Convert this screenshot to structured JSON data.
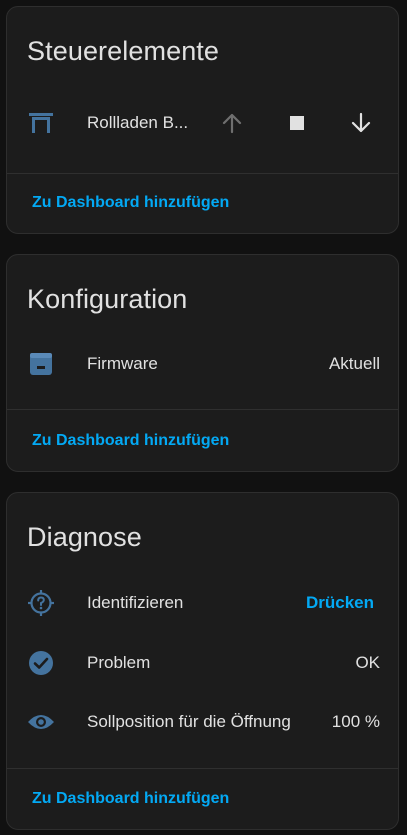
{
  "colors": {
    "accent": "#03a9f4",
    "icon": "#44739e",
    "text": "#e1e1e1",
    "disabled": "#6f6f6f"
  },
  "controls": {
    "title": "Steuerelemente",
    "entity": {
      "icon": "blinds-icon",
      "label": "Rollladen B..."
    },
    "buttons": [
      {
        "icon": "arrow-up-icon",
        "enabled": false
      },
      {
        "icon": "stop-icon",
        "enabled": true
      },
      {
        "icon": "arrow-down-icon",
        "enabled": true
      }
    ],
    "add_label": "Zu Dashboard hinzufügen"
  },
  "config": {
    "title": "Konfiguration",
    "rows": [
      {
        "icon": "package-icon",
        "label": "Firmware",
        "value": "Aktuell"
      }
    ],
    "add_label": "Zu Dashboard hinzufügen"
  },
  "diagnostics": {
    "title": "Diagnose",
    "rows": [
      {
        "icon": "crosshairs-question-icon",
        "label": "Identifizieren",
        "action": "Drücken"
      },
      {
        "icon": "check-circle-icon",
        "label": "Problem",
        "value": "OK"
      },
      {
        "icon": "eye-icon",
        "label": "Sollposition für die Öffnung",
        "value": "100 %"
      }
    ],
    "add_label": "Zu Dashboard hinzufügen"
  }
}
